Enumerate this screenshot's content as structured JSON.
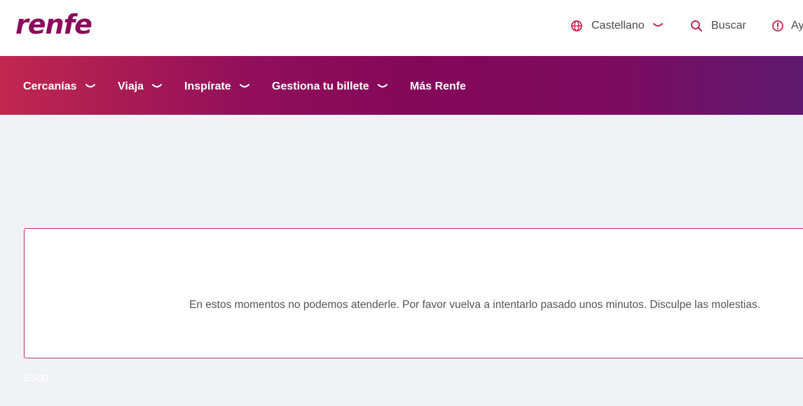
{
  "brand": {
    "logo_text": "renfe",
    "color": "#8a0b5c"
  },
  "header": {
    "language": {
      "label": "Castellano",
      "icon": "globe-icon"
    },
    "search": {
      "label": "Buscar",
      "icon": "search-icon"
    },
    "help": {
      "label": "Ay",
      "icon": "info-icon"
    },
    "accent_color": "#c2274f"
  },
  "nav": {
    "items": [
      {
        "label": "Cercanías",
        "has_dropdown": true
      },
      {
        "label": "Viaja",
        "has_dropdown": true
      },
      {
        "label": "Inspírate",
        "has_dropdown": true
      },
      {
        "label": "Gestiona tu billete",
        "has_dropdown": true
      },
      {
        "label": "Más Renfe",
        "has_dropdown": false
      }
    ],
    "gradient_start": "#c2274f",
    "gradient_end": "#5e1a6e"
  },
  "error": {
    "message": "En estos momentos no podemos atenderle. Por favor vuelva a intentarlo pasado unos minutos. Disculpe las molestias.",
    "code": "E500"
  }
}
